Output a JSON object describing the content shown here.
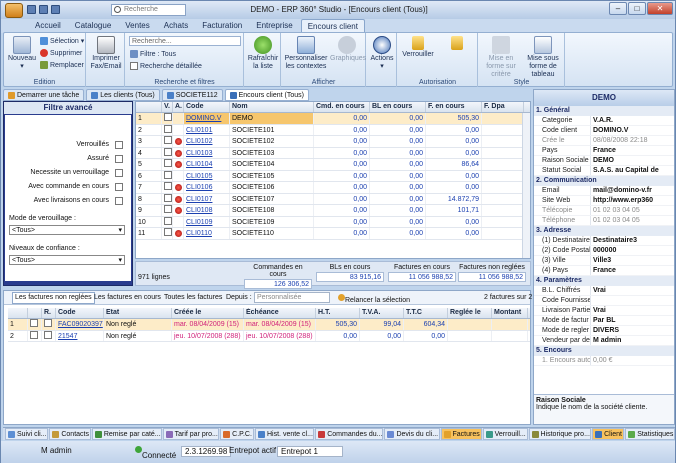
{
  "window": {
    "title": "DEMO - ERP 360° Studio - [Encours client (Tous)]",
    "search_placeholder": "Recherche",
    "min": "–",
    "max": "□",
    "close": "✕"
  },
  "menu_tabs": [
    "Accueil",
    "Catalogue",
    "Ventes",
    "Achats",
    "Facturation",
    "Entreprise",
    "Encours client"
  ],
  "ribbon": {
    "nouveau": "Nouveau",
    "selection": "Sélection",
    "supprimer": "Supprimer",
    "remplacer": "Remplacer",
    "edition": "Edition",
    "imprimer": "Imprimer Fax/Email",
    "search_placeholder": "Recherche...",
    "filtre": "Filtre : Tous",
    "recherche_detaillee": "Recherche détaillée",
    "rf_label": "Recherche et filtres",
    "rafraichir": "Rafraîchir la liste",
    "personnaliser": "Personnaliser les contextes",
    "graphiques": "Graphiques",
    "afficher": "Afficher",
    "actions": "Actions",
    "verrouiller": "Verrouiller",
    "deverrouiller": "Deverouiller",
    "autorisation": "Autorisation",
    "mise_critere": "Mise en forme sur critère",
    "mise_tableau": "Mise sous forme de tableau",
    "style": "Style"
  },
  "doc_tabs": [
    "Demarrer une tâche",
    "Les clients (Tous)",
    "SOCIETE112",
    "Encours client (Tous)"
  ],
  "filter_panel": {
    "title": "Filtre avancé",
    "verrouilles": "Verrouillés",
    "assure": "Assuré",
    "necessite": "Necessite un verrouillage",
    "avec_commande": "Avec commande en cours",
    "avec_livraisons": "Avec livraisons en cours",
    "mode_label": "Mode de verouillage :",
    "mode_value": "<Tous>",
    "niveau_label": "Niveaux de confiance :",
    "niveau_value": "<Tous>"
  },
  "grid": {
    "headers": [
      "",
      "V.",
      "A.",
      "Code",
      "Nom",
      "Cmd. en cours",
      "BL en cours",
      "F. en cours",
      "F. Dpa"
    ],
    "rows": [
      {
        "n": "1",
        "code": "DOMINO.V",
        "nom": "DEMO",
        "cmd": "0,00",
        "bl": "0,00",
        "f": "505,30"
      },
      {
        "n": "2",
        "code": "CLI0101",
        "nom": "SOCIETE101",
        "cmd": "0,00",
        "bl": "0,00",
        "f": "0,00"
      },
      {
        "n": "3",
        "code": "CLI0102",
        "nom": "SOCIETE102",
        "cmd": "0,00",
        "bl": "0,00",
        "f": "0,00"
      },
      {
        "n": "4",
        "code": "CLI0103",
        "nom": "SOCIETE103",
        "cmd": "0,00",
        "bl": "0,00",
        "f": "0,00"
      },
      {
        "n": "5",
        "code": "CLI0104",
        "nom": "SOCIETE104",
        "cmd": "0,00",
        "bl": "0,00",
        "f": "86,64"
      },
      {
        "n": "6",
        "code": "CLI0105",
        "nom": "SOCIETE105",
        "cmd": "0,00",
        "bl": "0,00",
        "f": "0,00"
      },
      {
        "n": "7",
        "code": "CLI0106",
        "nom": "SOCIETE106",
        "cmd": "0,00",
        "bl": "0,00",
        "f": "0,00"
      },
      {
        "n": "8",
        "code": "CLI0107",
        "nom": "SOCIETE107",
        "cmd": "0,00",
        "bl": "0,00",
        "f": "14.872,79"
      },
      {
        "n": "9",
        "code": "CLI0108",
        "nom": "SOCIETE108",
        "cmd": "0,00",
        "bl": "0,00",
        "f": "101,71"
      },
      {
        "n": "10",
        "code": "CLI0109",
        "nom": "SOCIETE109",
        "cmd": "0,00",
        "bl": "0,00",
        "f": "0,00"
      },
      {
        "n": "11",
        "code": "CLI0110",
        "nom": "SOCIETE110",
        "cmd": "0,00",
        "bl": "0,00",
        "f": "0,00"
      }
    ]
  },
  "totals": {
    "count": "971 lignes",
    "cmd_label": "Commandes en cours",
    "cmd": "126 306,52",
    "bl_label": "BLs en cours",
    "bl": "83 915,16",
    "f_label": "Factures en cours",
    "f": "11 056 988,52",
    "fnr_label": "Factures non reglées",
    "fnr": "11 056 988,52"
  },
  "lower": {
    "tab1": "Les factures non reglées",
    "tab2": "Les factures en cours",
    "tab3": "Toutes les factures",
    "depuis": "Depuis :",
    "depuis_value": "Personnalisée",
    "relancer": "Relancer la sélection",
    "count": "2 factures sur 2",
    "headers": [
      "",
      "",
      "R.",
      "Code",
      "Etat",
      "Créée le",
      "Échéance",
      "H.T.",
      "T.V.A.",
      "T.T.C",
      "Reglée le",
      "Montant"
    ],
    "rows": [
      {
        "n": "1",
        "code": "FAC09020397",
        "etat": "Non reglé",
        "cree": "mar. 08/04/2009 (15)",
        "ech": "mar. 08/04/2009 (15)",
        "ht": "505,30",
        "tva": "99,04",
        "ttc": "604,34"
      },
      {
        "n": "2",
        "code": "21547",
        "etat": "Non reglé",
        "cree": "jeu. 10/07/2008 (288)",
        "ech": "jeu. 10/07/2008 (288)",
        "ht": "0,00",
        "tva": "0,00",
        "ttc": "0,00"
      }
    ]
  },
  "right_panel": {
    "title": "DEMO",
    "s1": "1. Général",
    "s2": "2. Communication",
    "s3": "3. Adresse",
    "s4": "4. Paramètres",
    "s5": "5. Encours",
    "general": [
      {
        "k": "Categorie",
        "v": "V.A.R."
      },
      {
        "k": "Code client",
        "v": "DOMINO.V"
      },
      {
        "k": "Crée le",
        "v": "08/08/2008 22:18",
        "dim": true
      },
      {
        "k": "Pays",
        "v": "France"
      },
      {
        "k": "Raison Sociale",
        "v": "DEMO"
      },
      {
        "k": "Statut Social",
        "v": "S.A.S. au Capital de"
      }
    ],
    "comm": [
      {
        "k": "Email",
        "v": "mail@domino-v.fr"
      },
      {
        "k": "Site Web",
        "v": "http://www.erp360"
      },
      {
        "k": "Télécopie",
        "v": "01 02 03 04 05",
        "dim": true
      },
      {
        "k": "Téléphone",
        "v": "01 02 03 04 05",
        "dim": true
      }
    ],
    "adresse": [
      {
        "k": "(1) Destinataire",
        "v": "Destinataire3"
      },
      {
        "k": "(2) Code Postal",
        "v": "000000"
      },
      {
        "k": "(3) Ville",
        "v": "Ville3"
      },
      {
        "k": "(4) Pays",
        "v": "France"
      }
    ],
    "params": [
      {
        "k": "B.L. Chiffrés",
        "v": "Vrai"
      },
      {
        "k": "Code Fournisse",
        "v": ""
      },
      {
        "k": "Livraison Partie",
        "v": "Vrai"
      },
      {
        "k": "Mode de factur",
        "v": "Par BL"
      },
      {
        "k": "Mode de regler",
        "v": "DIVERS"
      },
      {
        "k": "Vendeur par de",
        "v": "M admin"
      }
    ],
    "encours": [
      {
        "k": "1. Encours auto",
        "v": "0,00 €",
        "dim": true
      }
    ],
    "desc_title": "Raison Sociale",
    "desc": "Indique le nom de la société cliente."
  },
  "bottom_tabs": [
    "Suivi cli...",
    "Contacts",
    "Remise par caté...",
    "Tarif par pro...",
    "C.P.C.",
    "Hist. vente cl...",
    "Commandes du...",
    "Devis du cli...",
    "Factures",
    "Verrouill...",
    "Historique pro...",
    "Client",
    "Statistiques"
  ],
  "status": {
    "user": "M admin",
    "connecte": "Connecté",
    "version": "2.3.1269.98",
    "entrepot_label": "Entrepot actif :",
    "entrepot": "Entrepot 1"
  }
}
